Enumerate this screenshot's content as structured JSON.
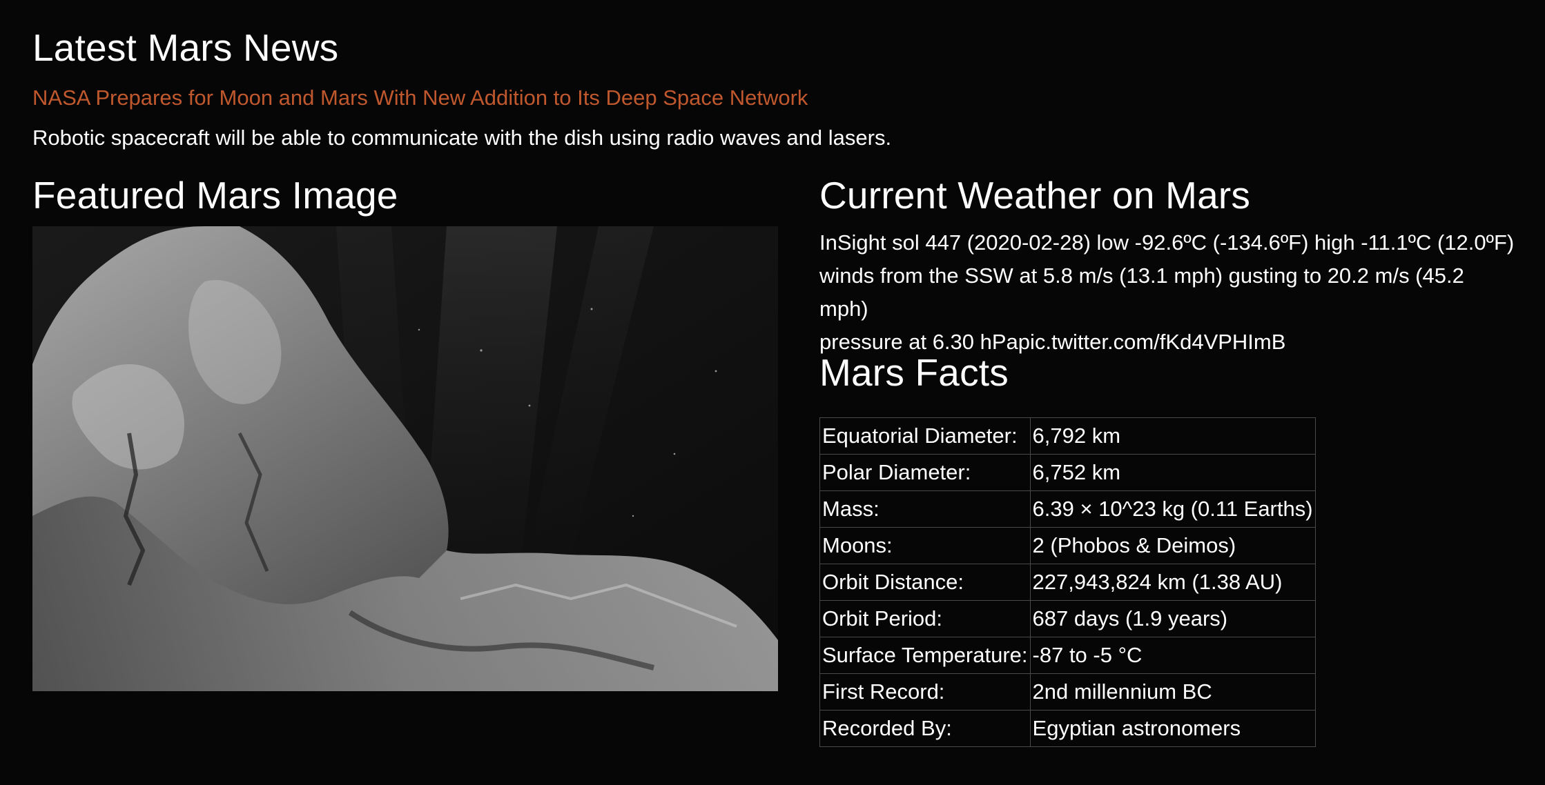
{
  "news": {
    "section_title": "Latest Mars News",
    "headline": "NASA Prepares for Moon and Mars With New Addition to Its Deep Space Network",
    "teaser": "Robotic spacecraft will be able to communicate with the dish using radio waves and lasers."
  },
  "featured_image": {
    "section_title": "Featured Mars Image",
    "alt": "Featured Mars Image"
  },
  "weather": {
    "section_title": "Current Weather on Mars",
    "line1": "InSight sol 447 (2020-02-28) low -92.6ºC (-134.6ºF) high -11.1ºC (12.0ºF)",
    "line2": "winds from the SSW at 5.8 m/s (13.1 mph) gusting to 20.2 m/s (45.2 mph)",
    "line3_text": "pressure at 6.30 hPa",
    "line3_link": "pic.twitter.com/fKd4VPHImB"
  },
  "facts": {
    "section_title": "Mars Facts",
    "rows": [
      {
        "label": "Equatorial Diameter:",
        "value": "6,792 km"
      },
      {
        "label": "Polar Diameter:",
        "value": "6,752 km"
      },
      {
        "label": "Mass:",
        "value": "6.39 × 10^23 kg (0.11 Earths)"
      },
      {
        "label": "Moons:",
        "value": "2 (Phobos & Deimos)"
      },
      {
        "label": "Orbit Distance:",
        "value": "227,943,824 km (1.38 AU)"
      },
      {
        "label": "Orbit Period:",
        "value": "687 days (1.9 years)"
      },
      {
        "label": "Surface Temperature:",
        "value": "-87 to -5 °C"
      },
      {
        "label": "First Record:",
        "value": "2nd millennium BC"
      },
      {
        "label": "Recorded By:",
        "value": "Egyptian astronomers"
      }
    ]
  },
  "colors": {
    "background": "#060606",
    "headline_link": "#c0582e",
    "text": "#ffffff",
    "table_border": "#4a4a4a"
  }
}
